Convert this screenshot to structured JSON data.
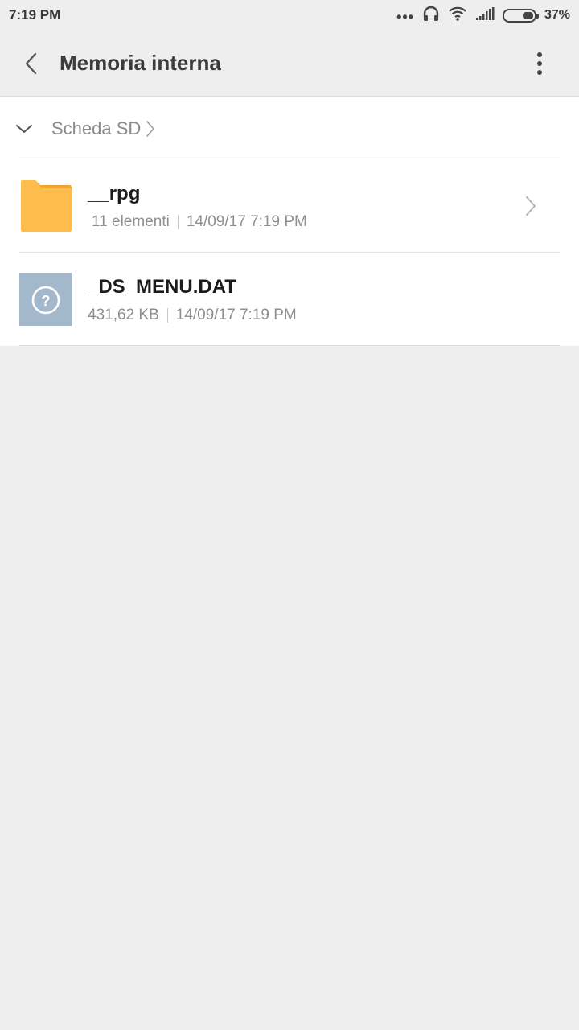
{
  "status_bar": {
    "time": "7:19 PM",
    "dots": "•••",
    "battery_text": "37%",
    "battery_level": 0.37
  },
  "toolbar": {
    "title": "Memoria interna",
    "back_icon": "chevron-left-icon",
    "more_icon": "more-vertical-icon"
  },
  "breadcrumb": {
    "label": "Scheda SD"
  },
  "files": [
    {
      "name": "__rpg",
      "type": "folder",
      "meta_left": "11 elementi",
      "meta_right": "14/09/17 7:19 PM",
      "icon": "folder-icon"
    },
    {
      "name": "_DS_MENU.DAT",
      "type": "unknown-file",
      "meta_left": "431,62 KB",
      "meta_right": "14/09/17 7:19 PM",
      "icon": "unknown-file-icon"
    }
  ],
  "colors": {
    "background": "#eeeeee",
    "panel": "#ffffff",
    "folder": "#fdbc4c",
    "folder_tab": "#f0a531",
    "unknown_file": "#a4b8cc"
  }
}
